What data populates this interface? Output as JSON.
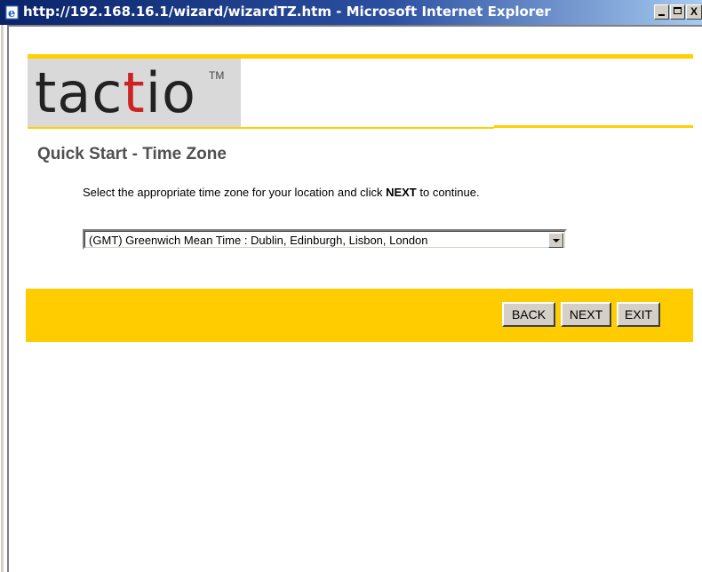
{
  "window": {
    "title": "http://192.168.16.1/wizard/wizardTZ.htm - Microsoft Internet Explorer",
    "icon": "ie-icon",
    "controls": {
      "minimize": "minimize-icon",
      "maximize": "maximize-icon",
      "close": "X"
    }
  },
  "brand": {
    "logo_part1": "tac",
    "logo_part2": "t",
    "logo_part3": "i",
    "logo_part4": "o",
    "trademark": "TM",
    "accent_color": "#ffcc00",
    "logo_color": "#cc2222"
  },
  "page": {
    "heading": "Quick Start - Time Zone",
    "instruction_prefix": "Select the appropriate time zone for your location and click ",
    "instruction_bold": "NEXT",
    "instruction_suffix": " to continue."
  },
  "timezone_select": {
    "selected": "(GMT) Greenwich Mean Time : Dublin, Edinburgh, Lisbon, London"
  },
  "buttons": {
    "back": "BACK",
    "next": "NEXT",
    "exit": "EXIT"
  }
}
